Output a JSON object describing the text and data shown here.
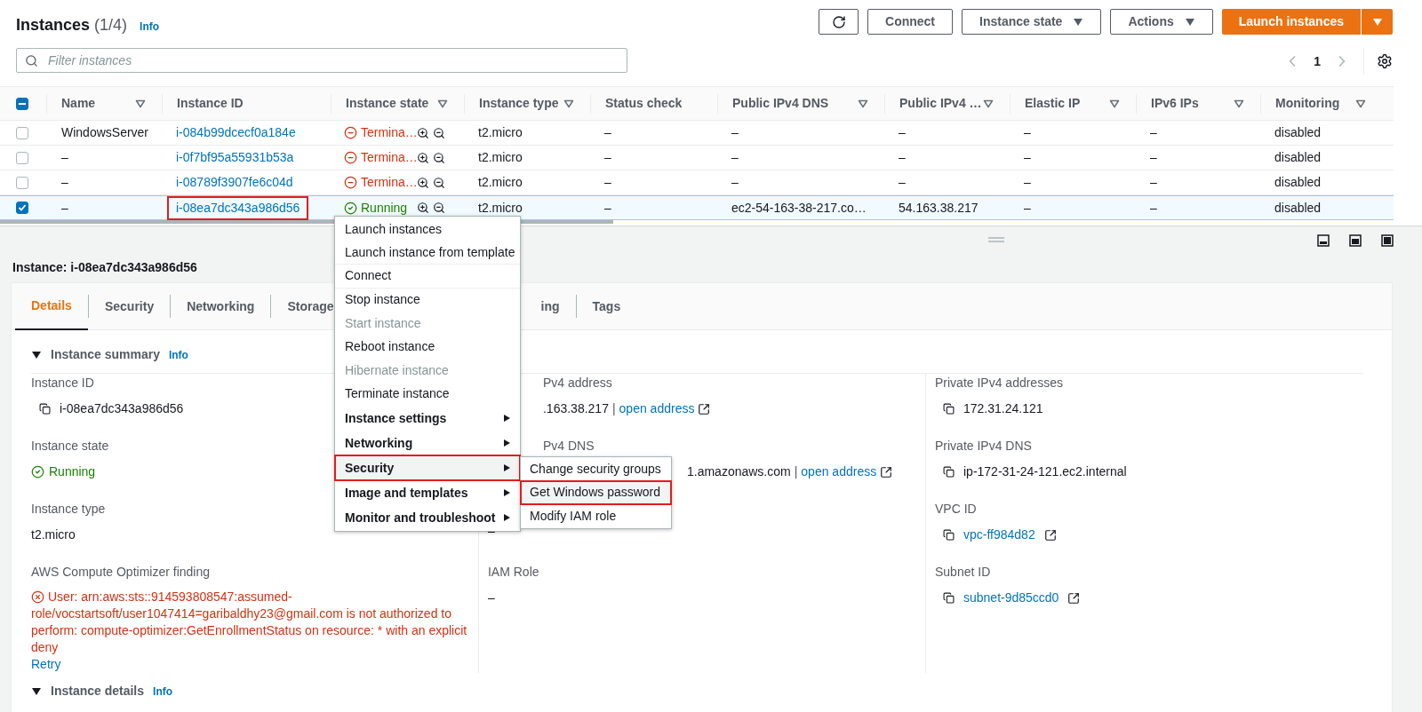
{
  "header": {
    "title": "Instances",
    "count": "(1/4)",
    "info": "Info",
    "buttons": [
      {
        "kind": "refresh"
      },
      {
        "kind": "plain",
        "label": "Connect"
      },
      {
        "kind": "dropdown",
        "label": "Instance state"
      },
      {
        "kind": "dropdown",
        "label": "Actions"
      },
      {
        "kind": "primary",
        "label": "Launch instances"
      }
    ]
  },
  "filter": {
    "placeholder": "Filter instances"
  },
  "pagination": {
    "page": "1"
  },
  "table": {
    "select_all": {
      "indeterminate": true
    },
    "columns": [
      {
        "label": "Name",
        "filter": true
      },
      {
        "label": "Instance ID",
        "filter": false
      },
      {
        "label": "Instance state",
        "filter": true
      },
      {
        "label": "Instance type",
        "filter": true
      },
      {
        "label": "Status check",
        "filter": false
      },
      {
        "label": "Public IPv4 DNS",
        "filter": true
      },
      {
        "label": "Public IPv4 …",
        "filter": true
      },
      {
        "label": "Elastic IP",
        "filter": true
      },
      {
        "label": "IPv6 IPs",
        "filter": true
      },
      {
        "label": "Monitoring",
        "filter": true
      }
    ],
    "rows": [
      {
        "selected": false,
        "outlined": false,
        "name": "WindowsServer",
        "instance_id": "i-084b99dcecf0a184e",
        "state": {
          "kind": "terminated",
          "label": "Termina…"
        },
        "type": "t2.micro",
        "status_check": "–",
        "public_dns": "–",
        "public_ip": "–",
        "elastic_ip": "–",
        "ipv6": "–",
        "monitoring": "disabled"
      },
      {
        "selected": false,
        "outlined": false,
        "name": "–",
        "instance_id": "i-0f7bf95a55931b53a",
        "state": {
          "kind": "terminated",
          "label": "Termina…"
        },
        "type": "t2.micro",
        "status_check": "–",
        "public_dns": "–",
        "public_ip": "–",
        "elastic_ip": "–",
        "ipv6": "–",
        "monitoring": "disabled"
      },
      {
        "selected": false,
        "outlined": false,
        "name": "–",
        "instance_id": "i-08789f3907fe6c04d",
        "state": {
          "kind": "terminated",
          "label": "Termina…"
        },
        "type": "t2.micro",
        "status_check": "–",
        "public_dns": "–",
        "public_ip": "–",
        "elastic_ip": "–",
        "ipv6": "–",
        "monitoring": "disabled"
      },
      {
        "selected": true,
        "outlined": true,
        "name": "–",
        "instance_id": "i-08ea7dc343a986d56",
        "state": {
          "kind": "running",
          "label": "Running"
        },
        "type": "t2.micro",
        "status_check": "–",
        "public_dns": "ec2-54-163-38-217.co…",
        "public_ip": "54.163.38.217",
        "elastic_ip": "–",
        "ipv6": "–",
        "monitoring": "disabled"
      }
    ]
  },
  "context_menu": {
    "items": [
      {
        "label": "Launch instances",
        "kind": "item",
        "disabled": false,
        "selected": false,
        "outlined": false,
        "separator_after": false
      },
      {
        "label": "Launch instance from template",
        "kind": "item",
        "disabled": false,
        "selected": false,
        "outlined": false,
        "separator_after": true
      },
      {
        "label": "Connect",
        "kind": "item",
        "disabled": false,
        "selected": false,
        "outlined": false,
        "separator_after": true
      },
      {
        "label": "Stop instance",
        "kind": "item",
        "disabled": false,
        "selected": false,
        "outlined": false,
        "separator_after": false
      },
      {
        "label": "Start instance",
        "kind": "item",
        "disabled": true,
        "selected": false,
        "outlined": false,
        "separator_after": false
      },
      {
        "label": "Reboot instance",
        "kind": "item",
        "disabled": false,
        "selected": false,
        "outlined": false,
        "separator_after": false
      },
      {
        "label": "Hibernate instance",
        "kind": "item",
        "disabled": true,
        "selected": false,
        "outlined": false,
        "separator_after": false
      },
      {
        "label": "Terminate instance",
        "kind": "item",
        "disabled": false,
        "selected": false,
        "outlined": false,
        "separator_after": false
      },
      {
        "label": "Instance settings",
        "kind": "submenu",
        "disabled": false,
        "selected": false,
        "outlined": false,
        "separator_after": false
      },
      {
        "label": "Networking",
        "kind": "submenu",
        "disabled": false,
        "selected": false,
        "outlined": false,
        "separator_after": false
      },
      {
        "label": "Security",
        "kind": "submenu",
        "disabled": false,
        "selected": true,
        "outlined": true,
        "separator_after": false
      },
      {
        "label": "Image and templates",
        "kind": "submenu",
        "disabled": false,
        "selected": false,
        "outlined": false,
        "separator_after": false
      },
      {
        "label": "Monitor and troubleshoot",
        "kind": "submenu",
        "disabled": false,
        "selected": false,
        "outlined": false,
        "separator_after": false
      }
    ],
    "submenu": [
      {
        "label": "Change security groups",
        "selected": false,
        "outlined": false
      },
      {
        "label": "Get Windows password",
        "selected": true,
        "outlined": true
      },
      {
        "label": "Modify IAM role",
        "selected": false,
        "outlined": false
      }
    ]
  },
  "detail_panel": {
    "title": "Instance: i-08ea7dc343a986d56",
    "tabs": [
      {
        "label": "Details",
        "selected": true
      },
      {
        "label": "Security",
        "selected": false
      },
      {
        "label": "Networking",
        "selected": false
      },
      {
        "label": "Storage",
        "selected": false
      },
      {
        "label": "ing",
        "selected": false
      },
      {
        "label": "Tags",
        "selected": false
      }
    ],
    "summary": {
      "title": "Instance summary",
      "info": "Info",
      "expanded": true
    },
    "left": [
      {
        "kind": "copy",
        "label": "Instance ID",
        "value": "i-08ea7dc343a986d56"
      },
      {
        "kind": "status",
        "label": "Instance state",
        "value": "Running"
      },
      {
        "kind": "text",
        "label": "Instance type",
        "value": "t2.micro"
      },
      {
        "kind": "error",
        "label": "AWS Compute Optimizer finding",
        "value": "User: arn:aws:sts::914593808547:assumed-role/vocstartsoft/user1047414=garibaldhy23@gmail.com is not authorized to perform: compute-optimizer:GetEnrollmentStatus on resource: * with an explicit deny",
        "link": "Retry"
      }
    ],
    "middle": [
      {
        "kind": "text_link",
        "label": "Pv4 address",
        "value": ".163.38.217",
        "separator": "|",
        "link": "open address"
      },
      {
        "kind": "text_link",
        "label": "Pv4 DNS",
        "value": "1.amazonaws.com",
        "separator": "|",
        "link": "open address"
      },
      {
        "kind": "text",
        "value": "–"
      },
      {
        "kind": "text",
        "label": "IAM Role",
        "value": "–"
      }
    ],
    "right": [
      {
        "kind": "copy",
        "label": "Private IPv4 addresses",
        "value": "172.31.24.121"
      },
      {
        "kind": "copy",
        "label": "Private IPv4 DNS",
        "value": "ip-172-31-24-121.ec2.internal"
      },
      {
        "kind": "copy_link",
        "label": "VPC ID",
        "link": "vpc-ff984d82"
      },
      {
        "kind": "copy_link",
        "label": "Subnet ID",
        "link": "subnet-9d85ccd0"
      }
    ],
    "details": {
      "title": "Instance details",
      "info": "Info",
      "expanded": true
    }
  }
}
